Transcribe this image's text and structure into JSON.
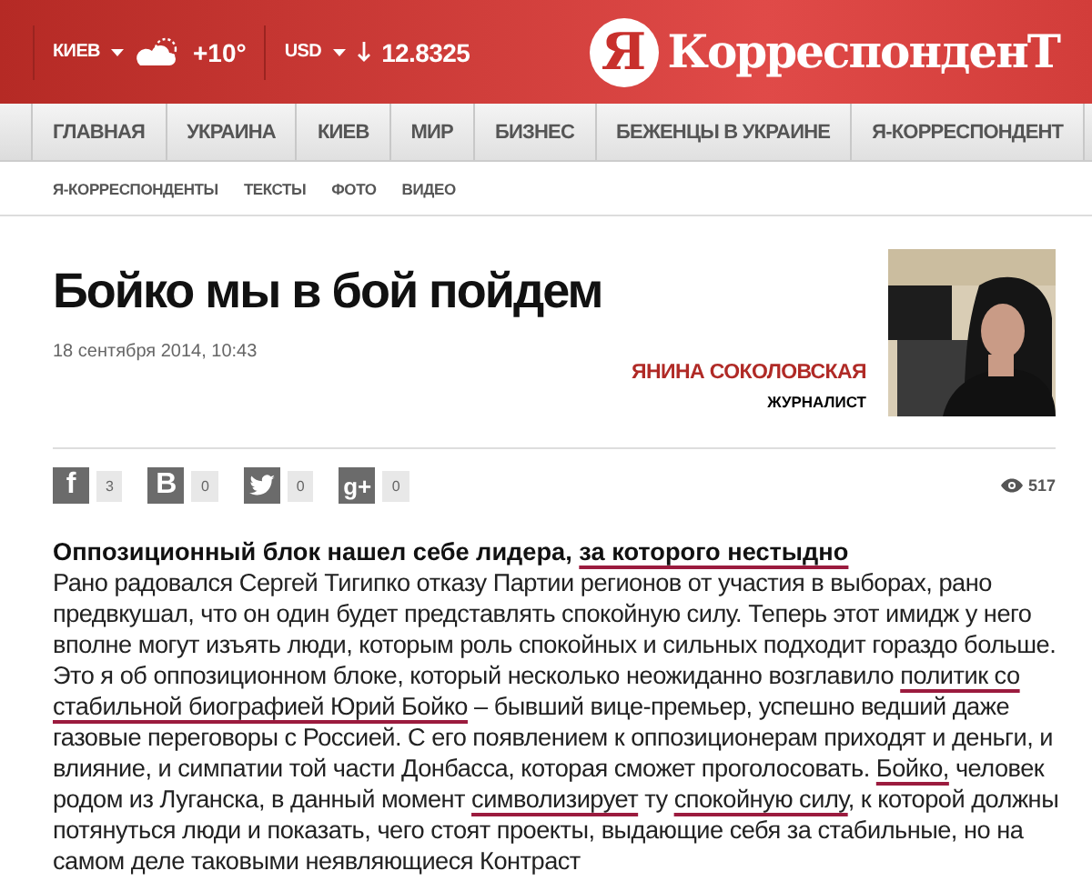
{
  "header": {
    "city": "КИЕВ",
    "temperature": "+10°",
    "currency": "USD",
    "rate": "12.8325",
    "logo_letter": "Я",
    "logo_text": "КорреспонденТ"
  },
  "nav": [
    {
      "label": "ГЛАВНАЯ"
    },
    {
      "label": "УКРАИНА"
    },
    {
      "label": "КИЕВ"
    },
    {
      "label": "МИР"
    },
    {
      "label": "БИЗНЕС"
    },
    {
      "label": "БЕЖЕНЦЫ В УКРАИНЕ"
    },
    {
      "label": "Я-КОРРЕСПОНДЕНТ"
    }
  ],
  "subnav": [
    {
      "label": "Я-КОРРЕСПОНДЕНТЫ"
    },
    {
      "label": "ТЕКСТЫ"
    },
    {
      "label": "ФОТО"
    },
    {
      "label": "ВИДЕО"
    }
  ],
  "article": {
    "title": "Бойко мы в бой пойдем",
    "date": "18 сентября 2014, 10:43",
    "author": "ЯНИНА СОКОЛОВСКАЯ",
    "role": "ЖУРНАЛИСТ",
    "shares": [
      {
        "kind": "facebook",
        "icon": "f",
        "count": "3"
      },
      {
        "kind": "vk",
        "icon": "B",
        "count": "0"
      },
      {
        "kind": "twitter",
        "count": "0"
      },
      {
        "kind": "gplus",
        "icon": "g+",
        "count": "0"
      }
    ],
    "views": "517",
    "lead": [
      {
        "text": "Оппозиционный блок нашел себе лидера, ",
        "underlined": false
      },
      {
        "text": "за которого нестыдно",
        "underlined": true
      }
    ],
    "body": [
      {
        "text": "Рано радовался Сергей Тигипко отказу Партии регионов от участия в выборах, рано предвкушал, что он один будет представлять спокойную силу. Теперь этот имидж у него вполне могут изъять люди, которым роль спокойных и сильных подходит гораздо больше. Это я об оппозиционном блоке, который несколько неожиданно возглавило ",
        "underlined": false
      },
      {
        "text": "политик со стабильной биографией Юрий Бойко",
        "underlined": true
      },
      {
        "text": " – бывший вице-премьер, успешно ведший даже газовые переговоры с Россией. С его появлением к оппозиционерам приходят и деньги, и влияние, и симпатии той части Донбасса, которая сможет проголосовать. ",
        "underlined": false
      },
      {
        "text": "Бойко,",
        "underlined": true
      },
      {
        "text": " человек родом из Луганска, в данный момент ",
        "underlined": false
      },
      {
        "text": "символизирует",
        "underlined": true
      },
      {
        "text": " ту ",
        "underlined": false
      },
      {
        "text": "спокойную силу",
        "underlined": true
      },
      {
        "text": ", к которой должны потянуться люди и показать, чего стоят проекты, выдающие себя за стабильные, но на самом деле таковыми неявляющиеся Контраст",
        "underlined": false
      }
    ]
  }
}
